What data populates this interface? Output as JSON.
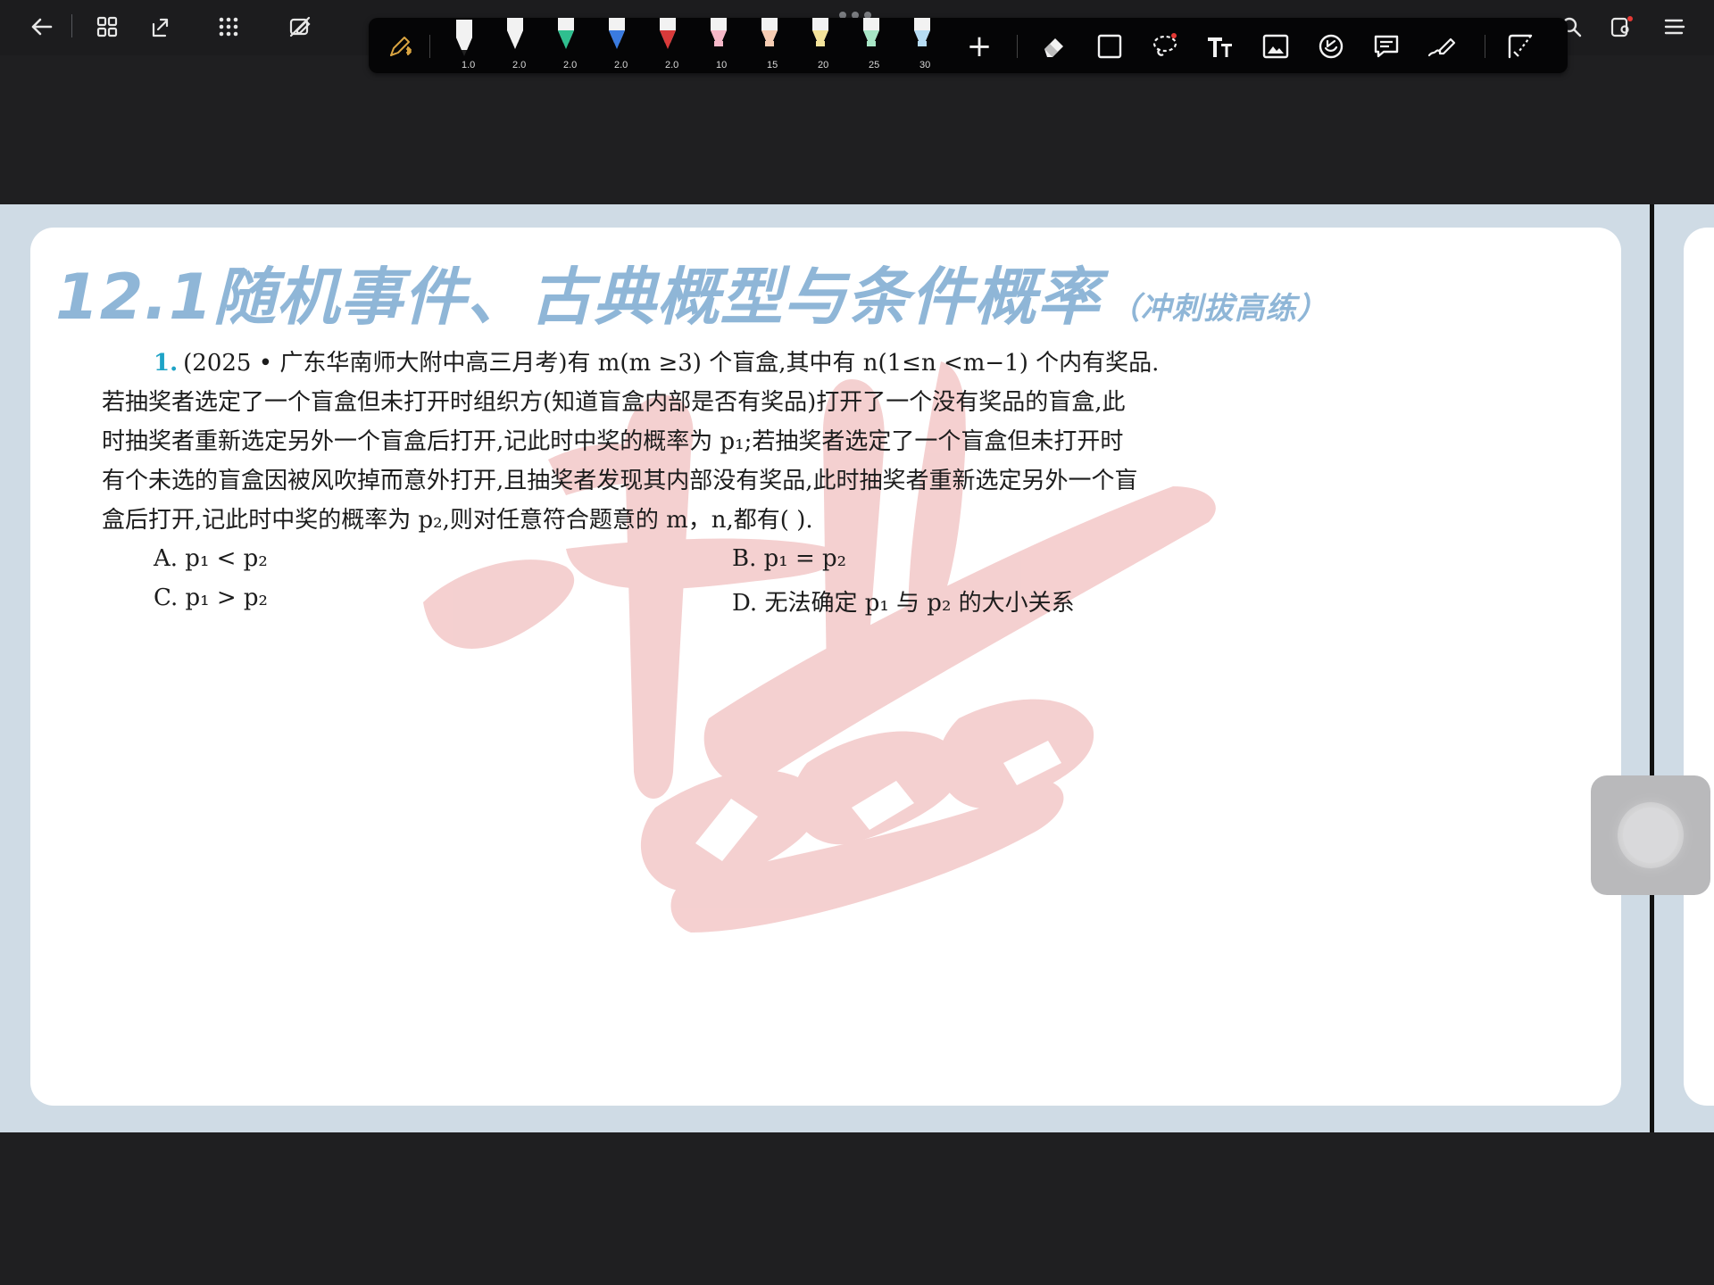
{
  "pen_toolbar": {
    "pens": [
      {
        "size": "1.0",
        "color": "#f2f2f2"
      },
      {
        "size": "2.0",
        "color": "#f2f2f2"
      },
      {
        "size": "2.0",
        "color": "#2fbf8f"
      },
      {
        "size": "2.0",
        "color": "#3a7be0"
      },
      {
        "size": "2.0",
        "color": "#d93a3a"
      },
      {
        "size": "10",
        "color": "#f6b8c8"
      },
      {
        "size": "15",
        "color": "#f7cdb3"
      },
      {
        "size": "20",
        "color": "#f4e39a"
      },
      {
        "size": "25",
        "color": "#a8e6c6"
      },
      {
        "size": "30",
        "color": "#b6dcf3"
      }
    ],
    "add_label": "+"
  },
  "document": {
    "title": "12.1随机事件、古典概型与条件概率",
    "title_sub": "（冲刺拔高练）",
    "question": {
      "number": "1.",
      "lines": [
        "(2025 • 广东华南师大附中高三月考)有 m(m ≥3) 个盲盒,其中有 n(1≤n <m−1) 个内有奖品.",
        "若抽奖者选定了一个盲盒但未打开时组织方(知道盲盒内部是否有奖品)打开了一个没有奖品的盲盒,此",
        "时抽奖者重新选定另外一个盲盒后打开,记此时中奖的概率为 p₁;若抽奖者选定了一个盲盒但未打开时",
        "有个未选的盲盒因被风吹掉而意外打开,且抽奖者发现其内部没有奖品,此时抽奖者重新选定另外一个盲",
        "盒后打开,记此时中奖的概率为 p₂,则对任意符合题意的 m，n,都有(      )."
      ],
      "choices": {
        "A": "A.  p₁ < p₂",
        "B": "B.  p₁ = p₂",
        "C": "C.  p₁ > p₂",
        "D": "D.  无法确定 p₁ 与 p₂ 的大小关系"
      }
    }
  },
  "colors": {
    "title": "#8fb6d7",
    "question_number": "#1ea3c6",
    "watermark": "#f3c8c8",
    "page_background": "#cfdbe5"
  }
}
